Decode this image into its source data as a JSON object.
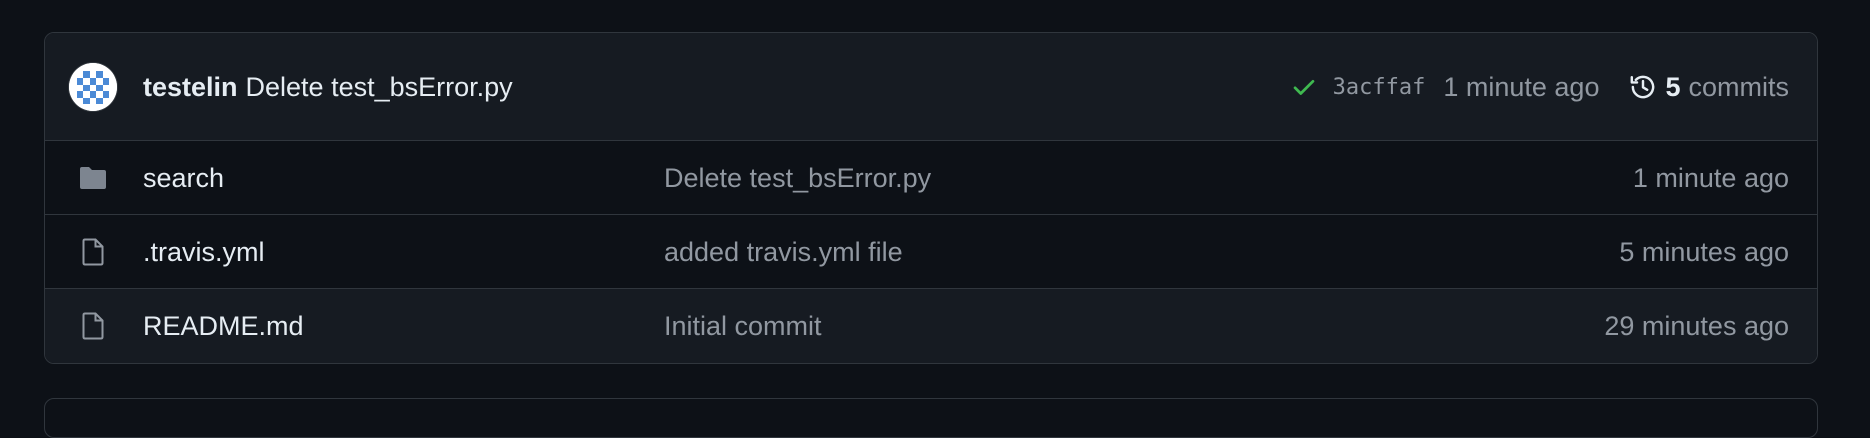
{
  "latest_commit": {
    "author": "testelin",
    "message": "Delete test_bsError.py",
    "status_icon": "check-icon",
    "status_color": "#3fb950",
    "sha": "3acffaf",
    "time": "1 minute ago",
    "commit_count": "5",
    "commits_label": "commits"
  },
  "files": [
    {
      "type": "folder",
      "icon": "folder-icon",
      "name": "search",
      "message": "Delete test_bsError.py",
      "time": "1 minute ago"
    },
    {
      "type": "file",
      "icon": "file-icon",
      "name": ".travis.yml",
      "message": "added travis.yml file",
      "time": "5 minutes ago"
    },
    {
      "type": "file",
      "icon": "file-icon",
      "name": "README.md",
      "message": "Initial commit",
      "time": "29 minutes ago"
    }
  ],
  "colors": {
    "background": "#0d1117",
    "header_background": "#161b22",
    "border": "#30363d",
    "text": "#e6edf3",
    "muted_text": "#9198a1",
    "folder_icon": "#7d8590",
    "avatar_accent": "#4b8ad6"
  }
}
